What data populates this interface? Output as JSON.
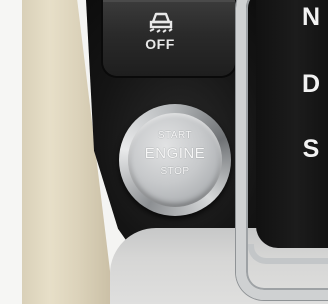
{
  "hdc_button": {
    "icon": "hill-descent-car-icon",
    "label": "OFF"
  },
  "start_button": {
    "line1": "START",
    "line2": "ENGINE",
    "line3": "STOP"
  },
  "gear_indicator": {
    "letters": [
      "N",
      "D",
      "S"
    ]
  },
  "colors": {
    "console_black": "#141414",
    "leather_beige": "#e0d7c0",
    "chrome_silver": "#cfd1d2",
    "gear_letter_white": "#f2f2f2"
  }
}
